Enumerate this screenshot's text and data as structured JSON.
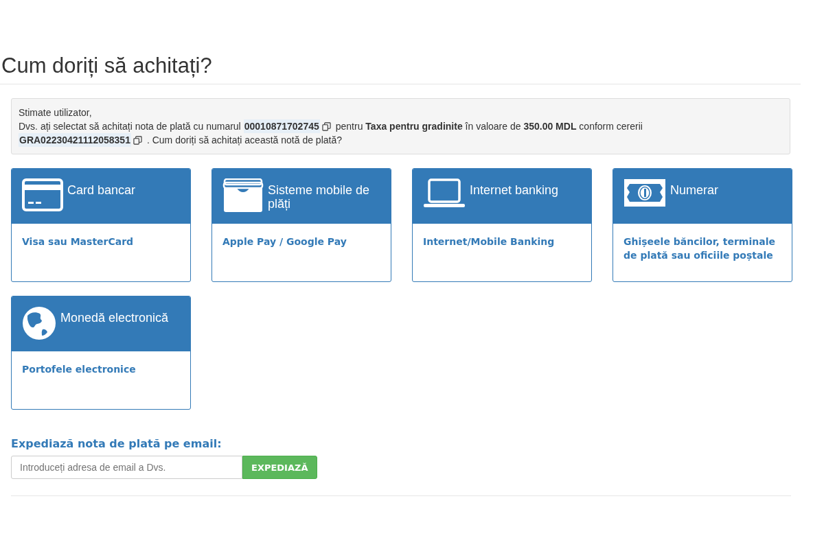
{
  "title": "Cum doriți să achitați?",
  "notice": {
    "greeting": "Stimate utilizator,",
    "lines": [
      [
        {
          "kind": "text",
          "text": "Dvs. ați selectat să achitați nota de plată cu numarul"
        },
        {
          "kind": "code",
          "text": "00010871702745"
        },
        {
          "kind": "text",
          "text": "pentru **Taxa pentru gradinite** în valoare de **350.00 MDL** conform cererii"
        }
      ],
      [
        {
          "kind": "code",
          "text": "GRA02230421112058351"
        },
        {
          "kind": "text",
          "text": ". Cum doriți să achitați această notă de plată?"
        }
      ]
    ]
  },
  "methods": [
    {
      "kind": "card",
      "title": "Card bancar",
      "description": "Visa sau MasterCard"
    },
    {
      "kind": "wallet",
      "title": "Sisteme mobile de plăți",
      "description": "Apple Pay / Google Pay"
    },
    {
      "kind": "laptop",
      "title": "Internet banking",
      "description": "Internet/Mobile Banking"
    },
    {
      "kind": "cash",
      "title": "Numerar",
      "description": "Ghișeele băncilor, terminale de plată sau oficiile poștale"
    },
    {
      "kind": "globe",
      "title": "Monedă electronică",
      "description": "Portofele electronice"
    }
  ],
  "email": {
    "heading": "Expediază nota de plată pe email:",
    "placeholder": "Introduceți adresa de email a Dvs.",
    "button": "EXPEDIAZĂ"
  }
}
